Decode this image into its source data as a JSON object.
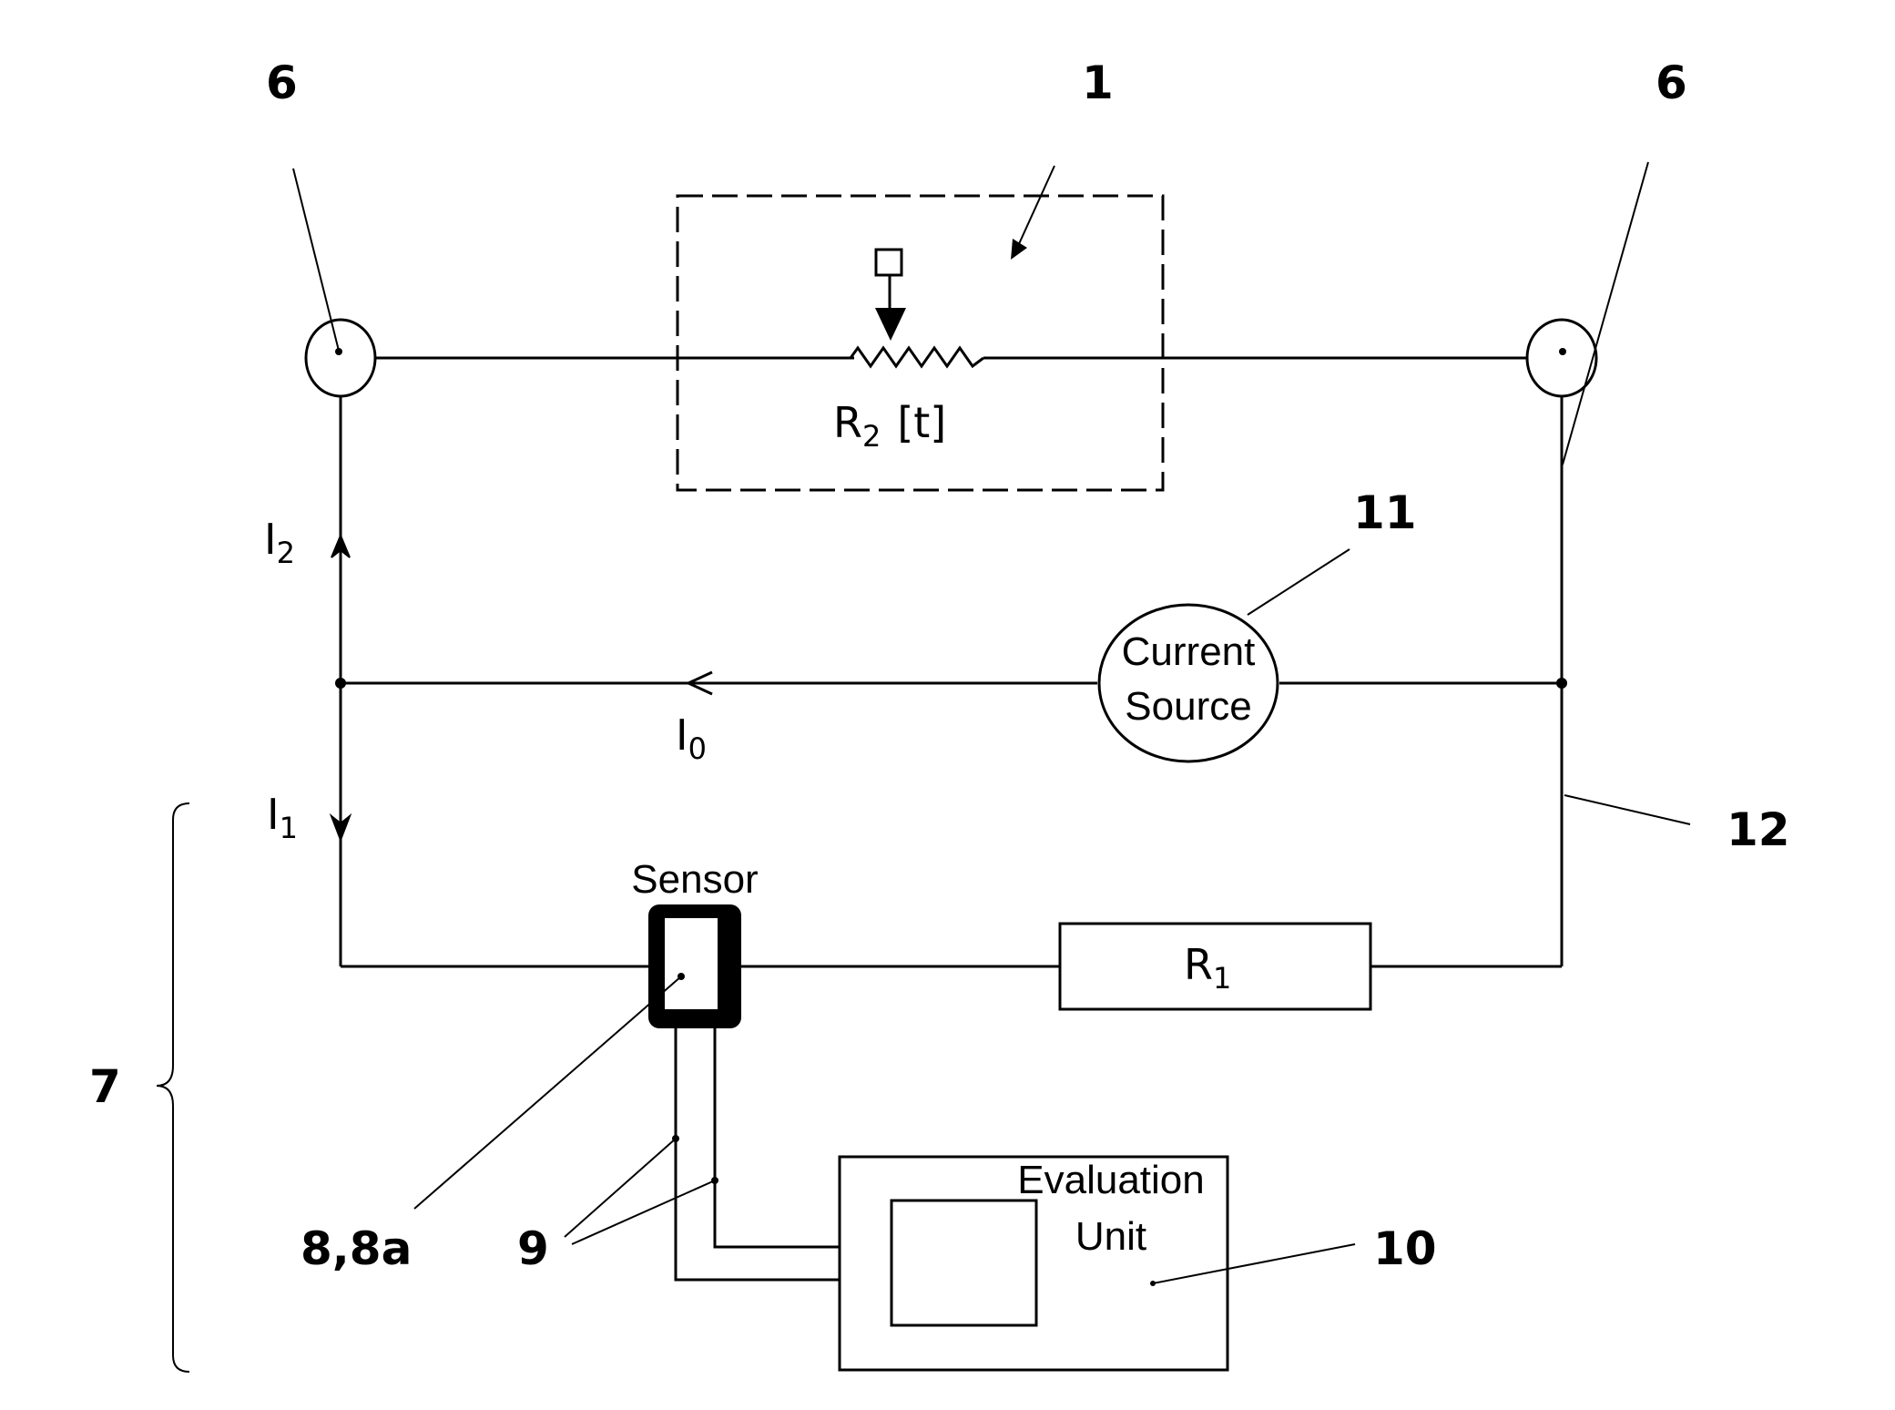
{
  "diagram": {
    "type": "circuit-schematic",
    "reference_numerals": {
      "device": "1",
      "terminal_left": "6",
      "terminal_right": "6",
      "current_source": "11",
      "line": "12",
      "measuring_branch": "7",
      "sensor": "8,8a",
      "leads": "9",
      "evaluation_unit": "10"
    },
    "components": {
      "variable_resistor": {
        "symbol": "R",
        "subscript": "2",
        "suffix": "[t]"
      },
      "resistor": {
        "symbol": "R",
        "subscript": "1"
      },
      "current_source_label": [
        "Current",
        "Source"
      ],
      "sensor_label": "Sensor",
      "evaluation_unit_label": [
        "Evaluation",
        "Unit"
      ]
    },
    "currents": {
      "i2": {
        "symbol": "I",
        "subscript": "2",
        "direction": "up"
      },
      "i0": {
        "symbol": "I",
        "subscript": "0",
        "direction": "left"
      },
      "i1": {
        "symbol": "I",
        "subscript": "1",
        "direction": "down"
      }
    }
  }
}
